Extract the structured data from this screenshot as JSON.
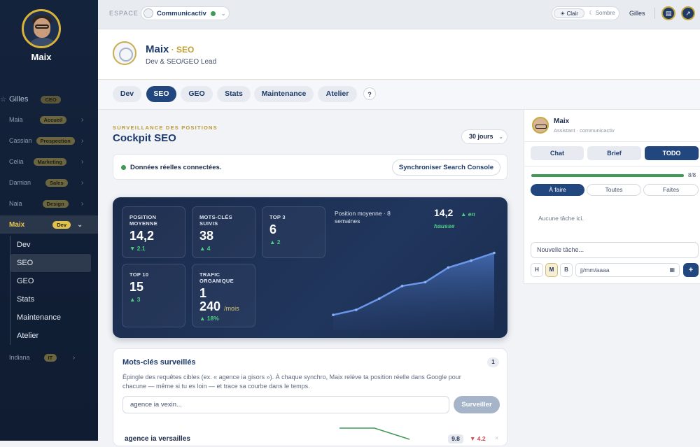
{
  "sidebar": {
    "profile_name": "Maix",
    "items": [
      {
        "name": "Gilles",
        "badge": "CEO"
      },
      {
        "name": "Maia",
        "badge": "Accueil"
      },
      {
        "name": "Cassian",
        "badge": "Prospection"
      },
      {
        "name": "Celia",
        "badge": "Marketing"
      },
      {
        "name": "Damian",
        "badge": "Sales"
      },
      {
        "name": "Naia",
        "badge": "Design"
      },
      {
        "name": "Maix",
        "badge": "Dev"
      },
      {
        "name": "Indiana",
        "badge": "IT"
      }
    ],
    "sub_items": [
      "Dev",
      "SEO",
      "GEO",
      "Stats",
      "Maintenance",
      "Atelier"
    ]
  },
  "topbar": {
    "espace_label": "ESPACE",
    "space_name": "Communicactiv",
    "theme_light": "Clair",
    "theme_dark": "Sombre",
    "user": "Gilles"
  },
  "header": {
    "name": "Maix",
    "sep": " · ",
    "section": "SEO",
    "subtitle": "Dev & SEO/GEO Lead"
  },
  "tabs": [
    "Dev",
    "SEO",
    "GEO",
    "Stats",
    "Maintenance",
    "Atelier",
    "?"
  ],
  "main": {
    "kicker": "SURVEILLANCE DES POSITIONS",
    "title": "Cockpit SEO",
    "period": "30 jours",
    "status_text": "Données réelles connectées.",
    "sync_button": "Synchroniser Search Console"
  },
  "kpis": [
    {
      "label_1": "POSITION",
      "label_2": "MOYENNE",
      "value": "14,2",
      "delta": "▼ 2.1"
    },
    {
      "label_1": "MOTS-CLÉS",
      "label_2": "SUIVIS",
      "value": "38",
      "delta": "▲ 4"
    },
    {
      "label_1": "TOP 3",
      "label_2": "",
      "value": "6",
      "delta": "▲ 2"
    },
    {
      "label_1": "TOP 10",
      "label_2": "",
      "value": "15",
      "delta": "▲ 3"
    },
    {
      "label_1": "TRAFIC",
      "label_2": "ORGANIQUE",
      "value_1": "1",
      "value_2": "240",
      "unit": "/mois",
      "delta": "▲ 18%"
    }
  ],
  "chart_data": {
    "type": "area",
    "caption_1": "Position moyenne · 8",
    "caption_2": "semaines",
    "current_value": "14,2",
    "trend_1": "▲ en",
    "trend_2": "hausse",
    "values": [
      1.5,
      3.1,
      6.6,
      10.6,
      11.8,
      16.4,
      18.6,
      21.0
    ]
  },
  "keywords": {
    "title": "Mots-clés surveillés",
    "count": "1",
    "desc": "Épingle des requêtes cibles (ex. « agence ia gisors »). À chaque synchro, Maix relève ta position réelle dans Google pour chacune — même si tu es loin — et trace sa courbe dans le temps.",
    "input_value": "agence ia vexin...",
    "button": "Surveiller",
    "rows": [
      {
        "name": "agence ia versailles",
        "position": "9.8",
        "change": "▼ 4.2",
        "delete": "×",
        "spark": [
          0,
          0,
          4
        ]
      }
    ]
  },
  "assistant": {
    "name": "Maix",
    "role": "Assistant · communicactiv",
    "tabs": [
      "Chat",
      "Brief",
      "TODO"
    ],
    "progress_text": "8/8",
    "progress_fraction": 1.0,
    "filters": [
      "À faire",
      "Toutes",
      "Faites"
    ],
    "empty": "Aucune tâche ici.",
    "new_task_placeholder": "Nouvelle tâche...",
    "priorities": [
      "H",
      "M",
      "B"
    ],
    "date_placeholder": "jj/mm/aaaa",
    "add": "+"
  }
}
